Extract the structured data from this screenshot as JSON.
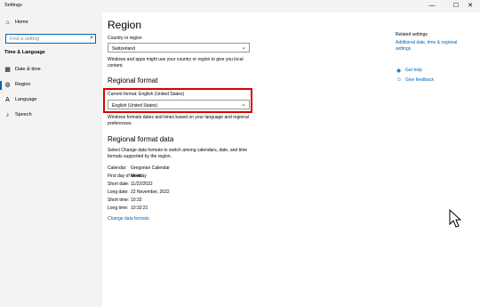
{
  "window": {
    "title": "Settings",
    "controls": {
      "minimize": "—",
      "maximize": "☐",
      "close": "✕"
    }
  },
  "sidebar": {
    "home_label": "Home",
    "search_placeholder": "Find a setting",
    "section_label": "Time & Language",
    "items": [
      {
        "label": "Date & time",
        "icon": "calendar-clock-icon",
        "active": false
      },
      {
        "label": "Region",
        "icon": "globe-icon",
        "active": true
      },
      {
        "label": "Language",
        "icon": "language-icon",
        "active": false
      },
      {
        "label": "Speech",
        "icon": "microphone-icon",
        "active": false
      }
    ]
  },
  "main": {
    "title": "Region",
    "country_label": "Country or region",
    "country_value": "Switzerland",
    "country_desc": "Windows and apps might use your country or region to give you local content.",
    "regional_format_heading": "Regional format",
    "current_format_label": "Current format: English (United States)",
    "format_value": "English (United States)",
    "format_desc": "Windows formats dates and times based on your language and regional preferences.",
    "format_data_heading": "Regional format data",
    "format_data_desc": "Select Change data formats to switch among calendars, date, and time formats supported by the region.",
    "format_data": [
      {
        "key": "Calendar:",
        "value": "Gregorian Calendar"
      },
      {
        "key": "First day of week:",
        "value": "Monday"
      },
      {
        "key": "Short date:",
        "value": "11/22/2022"
      },
      {
        "key": "Long date:",
        "value": "22 November, 2022"
      },
      {
        "key": "Short time:",
        "value": "10:32"
      },
      {
        "key": "Long time:",
        "value": "10:32:21"
      }
    ],
    "change_formats_link": "Change data formats"
  },
  "related": {
    "title": "Related settings",
    "link": "Additional date, time & regional settings",
    "get_help": "Get help",
    "give_feedback": "Give feedback"
  },
  "colors": {
    "accent": "#0063b1",
    "highlight": "#d90000",
    "sidebar_bg": "#f3f3f3"
  }
}
